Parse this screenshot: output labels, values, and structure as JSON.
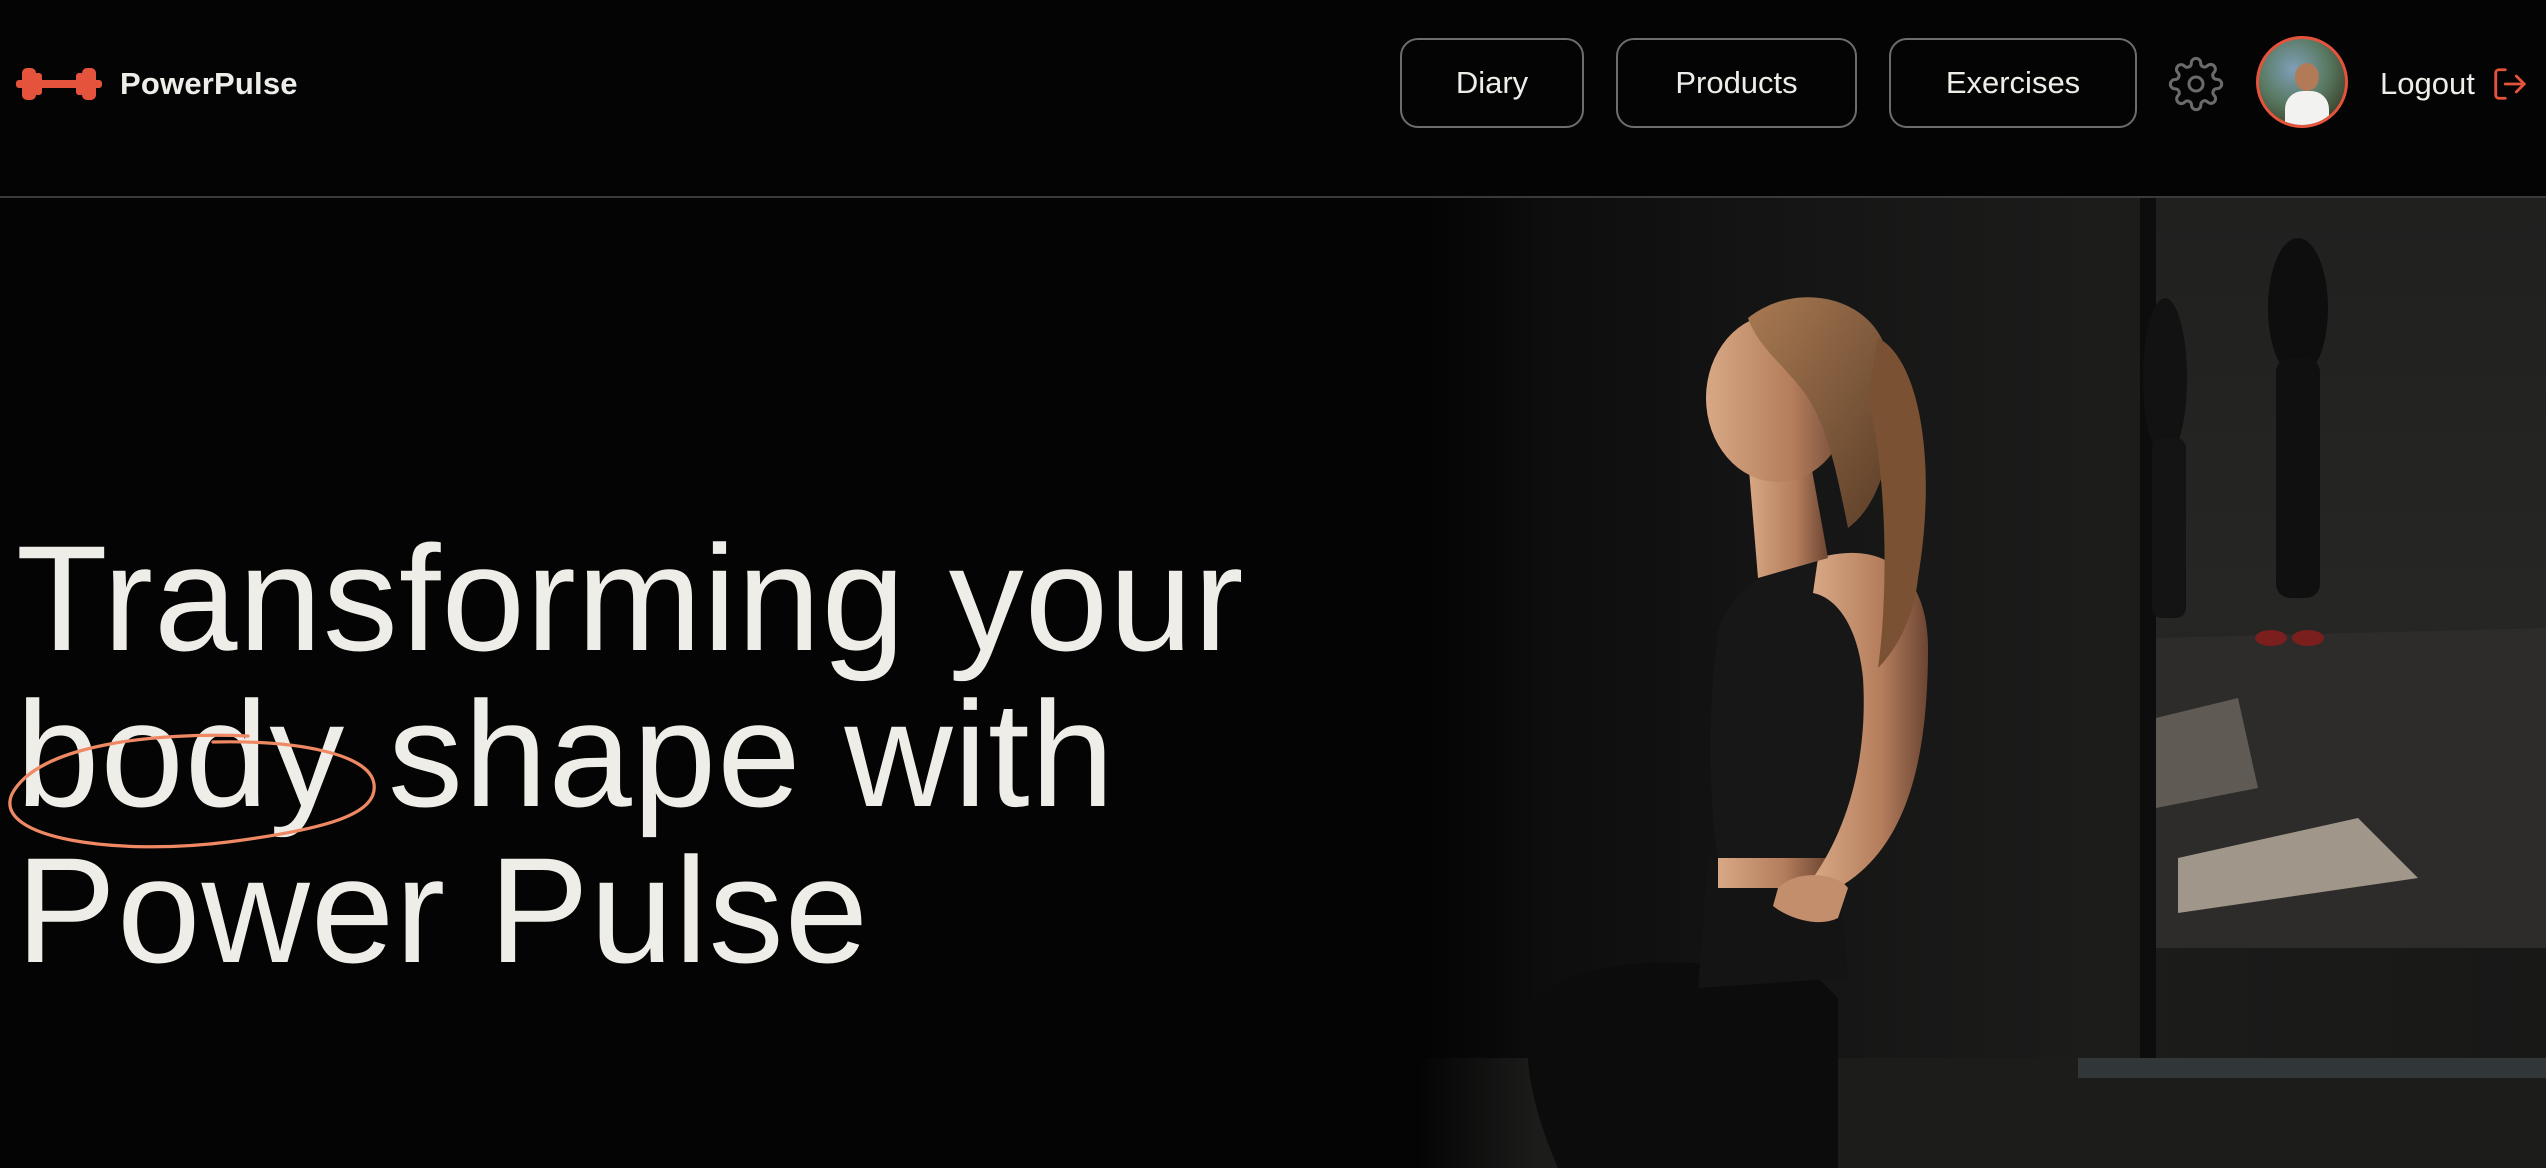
{
  "brand": {
    "name": "PowerPulse",
    "accent_color": "#e6533c",
    "logo_icon": "dumbbell-icon"
  },
  "nav": {
    "items": [
      {
        "label": "Diary"
      },
      {
        "label": "Products"
      },
      {
        "label": "Exercises"
      }
    ],
    "settings_icon": "gear-icon",
    "avatar_icon": "user-avatar",
    "logout_label": "Logout",
    "logout_icon": "logout-icon"
  },
  "hero": {
    "line1": "Transforming your",
    "line2_highlight": "body",
    "line2_rest": " shape with",
    "line3": "Power Pulse",
    "image": "woman-exercising-photo"
  },
  "colors": {
    "background": "#040404",
    "text": "#efede8",
    "accent": "#e6533c",
    "highlight_stroke": "#ef8964"
  }
}
